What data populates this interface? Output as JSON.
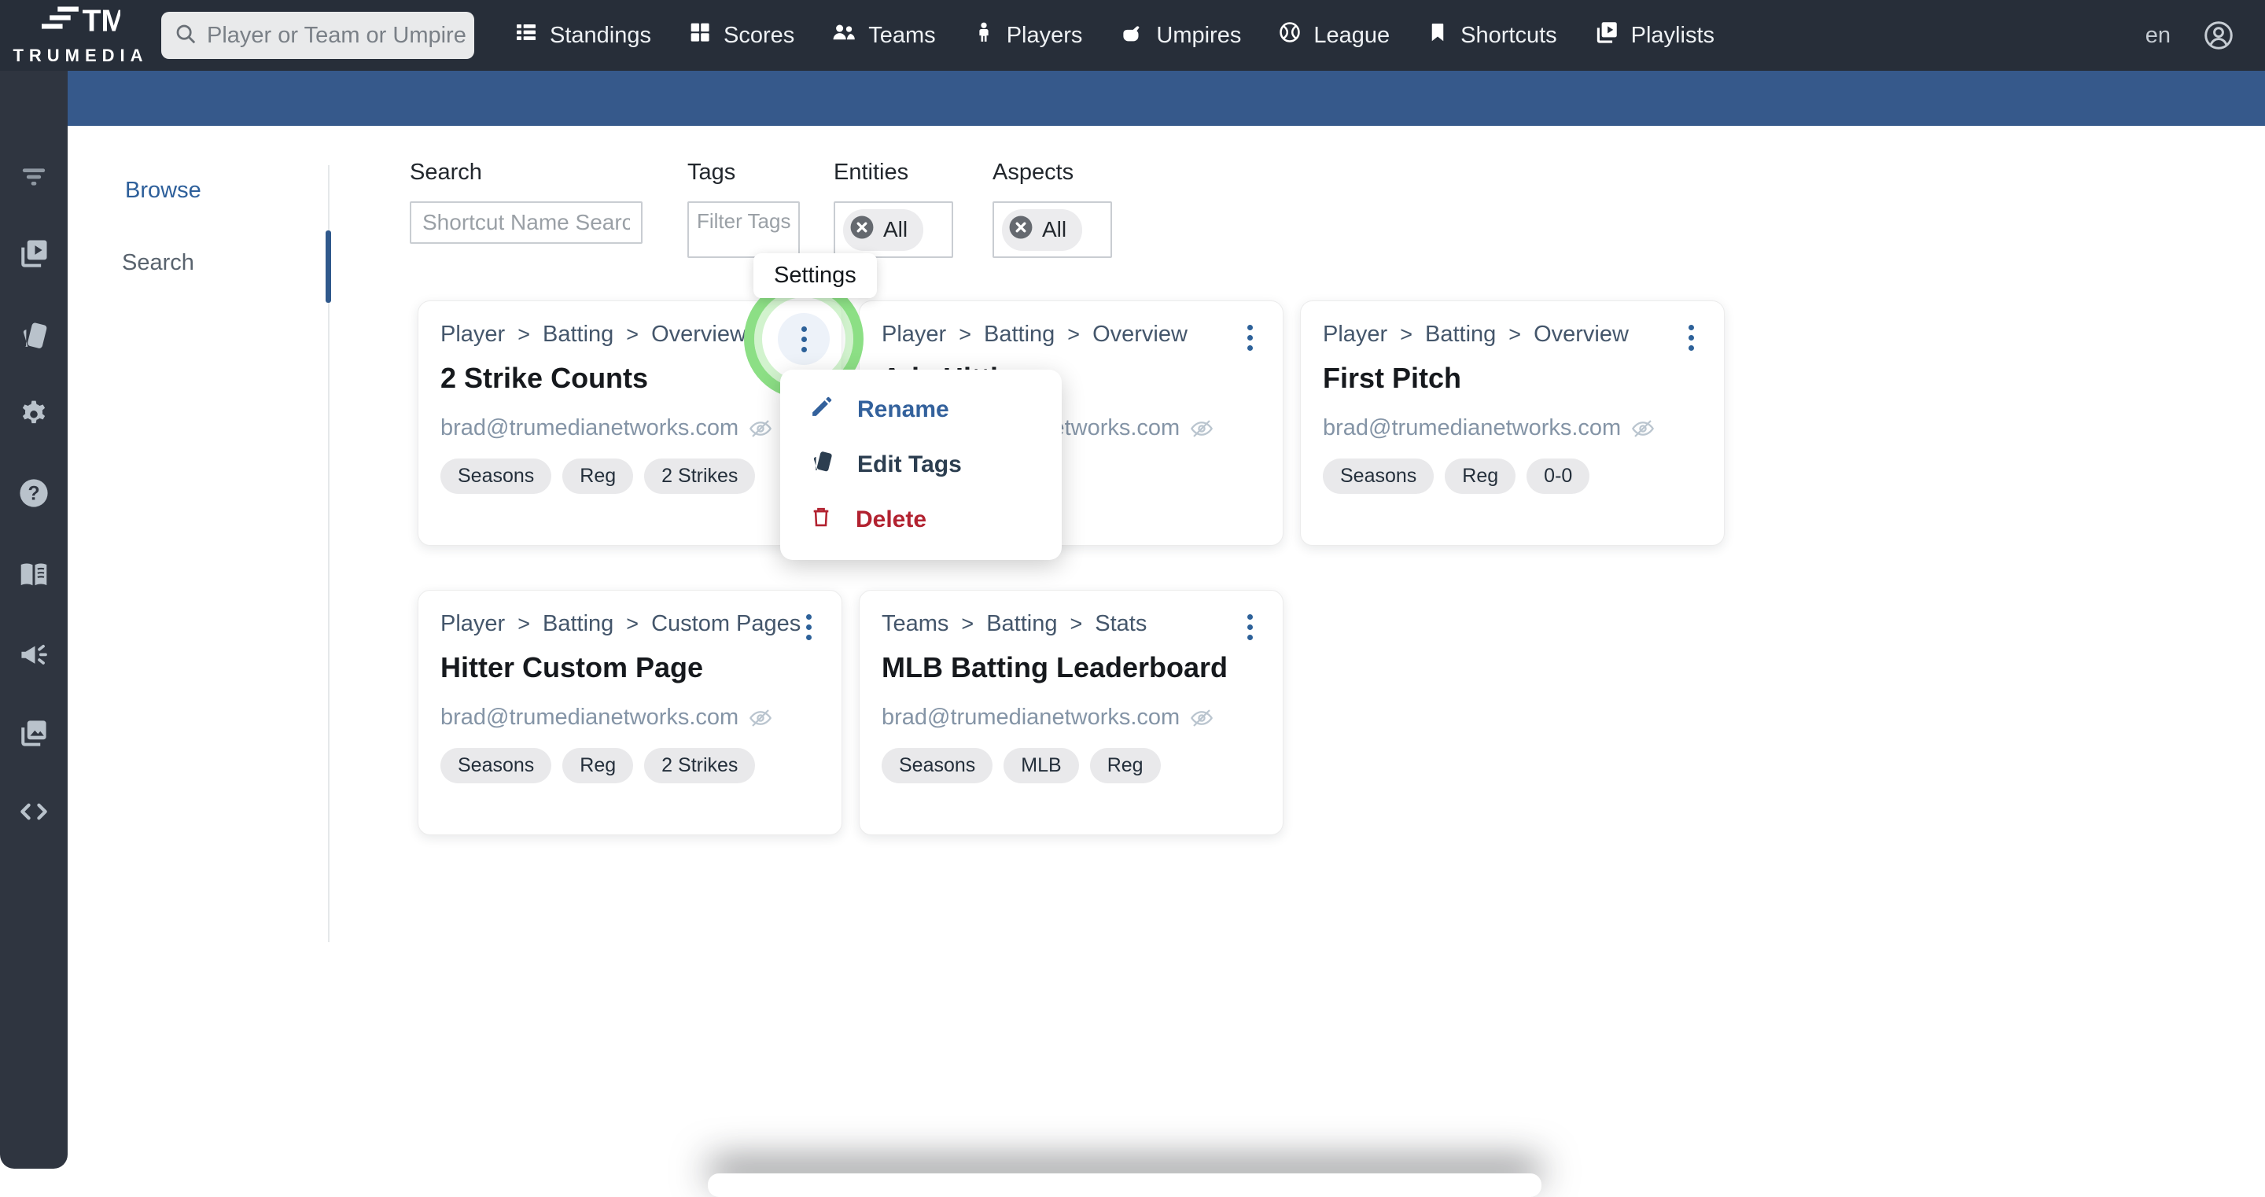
{
  "brand": {
    "name": "TRUMEDIA"
  },
  "nav": {
    "search_placeholder": "Player or Team or Umpire",
    "items": [
      {
        "label": "Standings",
        "icon": "standings-icon"
      },
      {
        "label": "Scores",
        "icon": "scores-icon"
      },
      {
        "label": "Teams",
        "icon": "teams-icon"
      },
      {
        "label": "Players",
        "icon": "players-icon"
      },
      {
        "label": "Umpires",
        "icon": "umpires-icon"
      },
      {
        "label": "League",
        "icon": "league-icon"
      },
      {
        "label": "Shortcuts",
        "icon": "bookmark-icon"
      },
      {
        "label": "Playlists",
        "icon": "playlists-icon"
      }
    ],
    "language": "en"
  },
  "sidebar": {
    "icons": [
      "filter",
      "playlists",
      "tags",
      "settings",
      "help",
      "guide-book",
      "announcements",
      "media-gallery",
      "embed-code"
    ]
  },
  "subnav": {
    "items": [
      {
        "label": "Browse"
      },
      {
        "label": "Search"
      }
    ]
  },
  "filters": {
    "search": {
      "label": "Search",
      "placeholder": "Shortcut Name Search"
    },
    "tags": {
      "label": "Tags",
      "placeholder": "Filter Tags"
    },
    "entities": {
      "label": "Entities",
      "value": "All"
    },
    "aspects": {
      "label": "Aspects",
      "value": "All"
    }
  },
  "tooltip": {
    "label": "Settings"
  },
  "menu": {
    "items": [
      {
        "label": "Rename",
        "icon": "pencil-icon",
        "color": "#33619C"
      },
      {
        "label": "Edit Tags",
        "icon": "tag-icon",
        "color": "#2C3E50"
      },
      {
        "label": "Delete",
        "icon": "trash-icon",
        "color": "#B22230"
      }
    ]
  },
  "cards": [
    {
      "breadcrumb": [
        "Player",
        "Batting",
        "Overview"
      ],
      "title": "2 Strike Counts",
      "owner": "brad@trumedianetworks.com",
      "tags": [
        "Seasons",
        "Reg",
        "2 Strikes"
      ],
      "highlighted": true
    },
    {
      "breadcrumb": [
        "Player",
        "Batting",
        "Overview"
      ],
      "title": "Adv Hitting",
      "owner": "brad@trumedianetworks.com",
      "tags": []
    },
    {
      "breadcrumb": [
        "Player",
        "Batting",
        "Overview"
      ],
      "title": "First Pitch",
      "owner": "brad@trumedianetworks.com",
      "tags": [
        "Seasons",
        "Reg",
        "0-0"
      ]
    },
    {
      "breadcrumb": [
        "Player",
        "Batting",
        "Custom Pages"
      ],
      "title": "Hitter Custom Page",
      "owner": "brad@trumedianetworks.com",
      "tags": [
        "Seasons",
        "Reg",
        "2 Strikes"
      ]
    },
    {
      "breadcrumb": [
        "Teams",
        "Batting",
        "Stats"
      ],
      "title": "MLB Batting Leaderboard",
      "owner": "brad@trumedianetworks.com",
      "tags": [
        "Seasons",
        "MLB",
        "Reg"
      ]
    }
  ],
  "colors": {
    "nav_bg": "#272E39",
    "sidebar_bg": "#2F3540",
    "secondary_bar": "#36598B",
    "link_blue": "#2D5F9A",
    "breadcrumb": "#44566B",
    "kebab_blue": "#2D6199",
    "menu_rename": "#33619C",
    "menu_edit": "#2C3E50",
    "menu_delete": "#B22230",
    "highlight_ring_green": "#8CDF85"
  }
}
